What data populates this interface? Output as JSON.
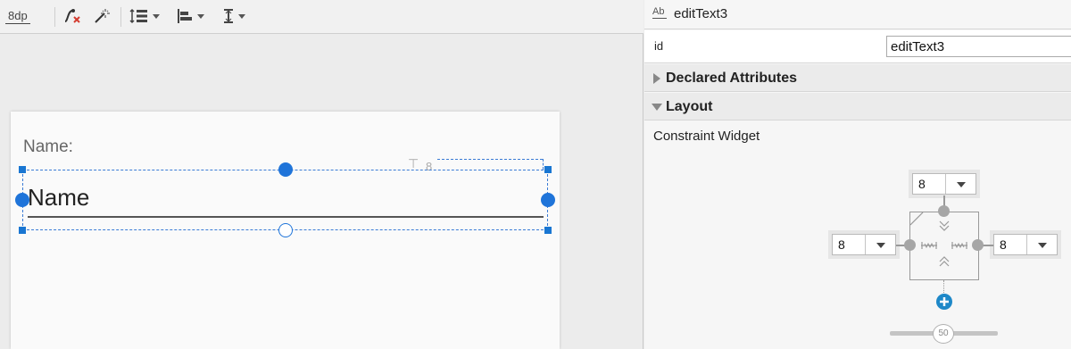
{
  "toolbar": {
    "margin_label": "8dp",
    "icons": [
      "clear-constraints-icon",
      "infer-constraints-icon",
      "pack-icon",
      "align-icon",
      "guideline-icon"
    ]
  },
  "canvas": {
    "label_text": "Name:",
    "edittext_value": "Name",
    "top_margin_marker": "8"
  },
  "properties": {
    "widget_icon_text": "Ab",
    "title": "editText3",
    "id_label": "id",
    "id_value": "editText3",
    "sections": {
      "declared": "Declared Attributes",
      "layout": "Layout"
    },
    "constraint_widget_label": "Constraint Widget",
    "margins": {
      "top": "8",
      "left": "8",
      "right": "8"
    },
    "bias_value": "50"
  },
  "colors": {
    "selection_blue": "#1f74d9",
    "add_constraint": "#1e88c8"
  }
}
